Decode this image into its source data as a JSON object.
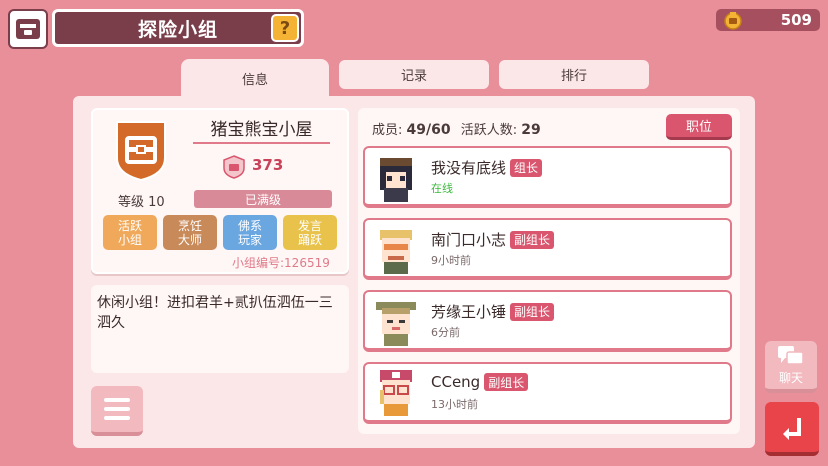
{
  "header": {
    "title": "探险小组",
    "help_label": "?",
    "coins": "509"
  },
  "tabs": [
    {
      "label": "信息",
      "active": true
    },
    {
      "label": "记录",
      "active": false
    },
    {
      "label": "排行",
      "active": false
    }
  ],
  "group": {
    "name": "猪宝熊宝小屋",
    "score": "373",
    "level": "等级 10",
    "status": "已满级",
    "tags": [
      {
        "label": "活跃\n小组",
        "color": "#f0a85a"
      },
      {
        "label": "烹饪\n大师",
        "color": "#c98a5a"
      },
      {
        "label": "佛系\n玩家",
        "color": "#6aa6e0"
      },
      {
        "label": "发言\n踊跃",
        "color": "#e8c24a"
      }
    ],
    "group_id": "小组编号:126519",
    "description": "休闲小组！进扣君羊+贰扒伍泗伍一三泗久"
  },
  "members": {
    "count_label": "成员:",
    "count_value": "49/60",
    "active_label": "活跃人数:",
    "active_value": "29",
    "role_button": "职位",
    "list": [
      {
        "name": "我没有底线",
        "role": "组长",
        "status": "在线",
        "online": true
      },
      {
        "name": "南门口小志",
        "role": "副组长",
        "status": "9小时前",
        "online": false
      },
      {
        "name": "芳缘王小锤",
        "role": "副组长",
        "status": "6分前",
        "online": false
      },
      {
        "name": "CCeng",
        "role": "副组长",
        "status": "13小时前",
        "online": false
      }
    ]
  },
  "side": {
    "chat_label": "聊天"
  },
  "colors": {
    "background": "#e98f99",
    "accent": "#d9566e",
    "title_bar": "#7a3e4b"
  }
}
